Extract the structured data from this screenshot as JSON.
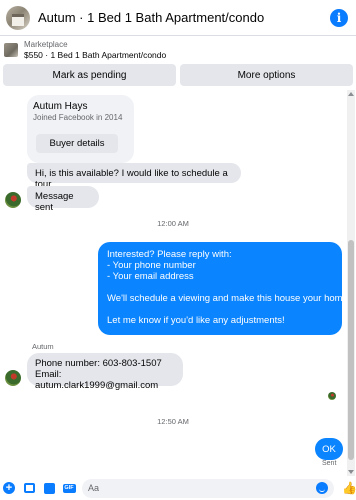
{
  "header": {
    "title": "Autum · 1 Bed 1 Bath Apartment/condo",
    "info_icon": "info-icon"
  },
  "marketplace": {
    "label": "Marketplace",
    "listing": "$550 · 1 Bed 1 Bath Apartment/condo"
  },
  "actions": {
    "pending_label": "Mark as pending",
    "more_label": "More options"
  },
  "buyer_card": {
    "name": "Autum Hays",
    "joined": "Joined Facebook in 2014",
    "details_label": "Buyer details"
  },
  "messages": {
    "incoming_1": "Hi, is this available? I would like to schedule a tour",
    "incoming_2": "Message sent",
    "time_1": "12:00 AM",
    "outgoing_lines": [
      "Interested? Please reply with:",
      "- Your phone number",
      "- Your email address",
      "",
      "We'll schedule a viewing and make this house your home!",
      "",
      "Let me know if you'd like any adjustments!"
    ],
    "sender_name": "Autum",
    "phone_line": "Phone number: 603-803-1507",
    "email_line": "Email: autum.clark1999@gmail.com",
    "time_2": "12:50 AM",
    "ok_text": "OK",
    "sent_label": "Sent"
  },
  "composer": {
    "placeholder": "Aa"
  },
  "colors": {
    "accent": "#0a84ff",
    "bubble_in": "#e4e6eb",
    "button_bg": "#e4e6eb"
  }
}
